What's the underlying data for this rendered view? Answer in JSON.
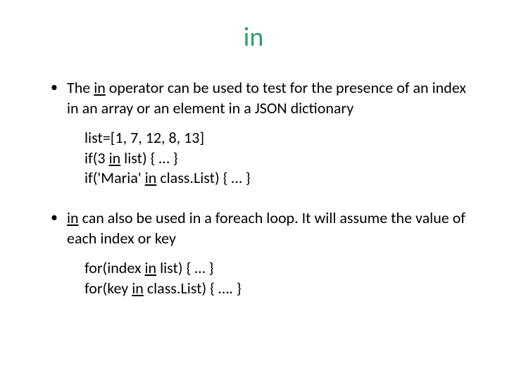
{
  "title": "in",
  "bullets": [
    {
      "pre": "The ",
      "op": "in",
      "post": " operator can be used to test for the presence of an index in an array or an element in a JSON dictionary",
      "code": [
        {
          "full": "list=[1, 7, 12, 8,  13]"
        },
        {
          "pre": "if(3 ",
          "op": "in",
          "post": " list) { … }"
        },
        {
          "pre": "if('Maria' ",
          "op": "in",
          "post": " class.List) { … }"
        }
      ]
    },
    {
      "pre": "",
      "op": "in",
      "post": " can also be used in a foreach loop.  It will assume the value of  each index or key",
      "code": [
        {
          "pre": "for(index ",
          "op": "in",
          "post": " list) { … }"
        },
        {
          "pre": "for(key ",
          "op": "in",
          "post": " class.List) { ….   }"
        }
      ]
    }
  ]
}
